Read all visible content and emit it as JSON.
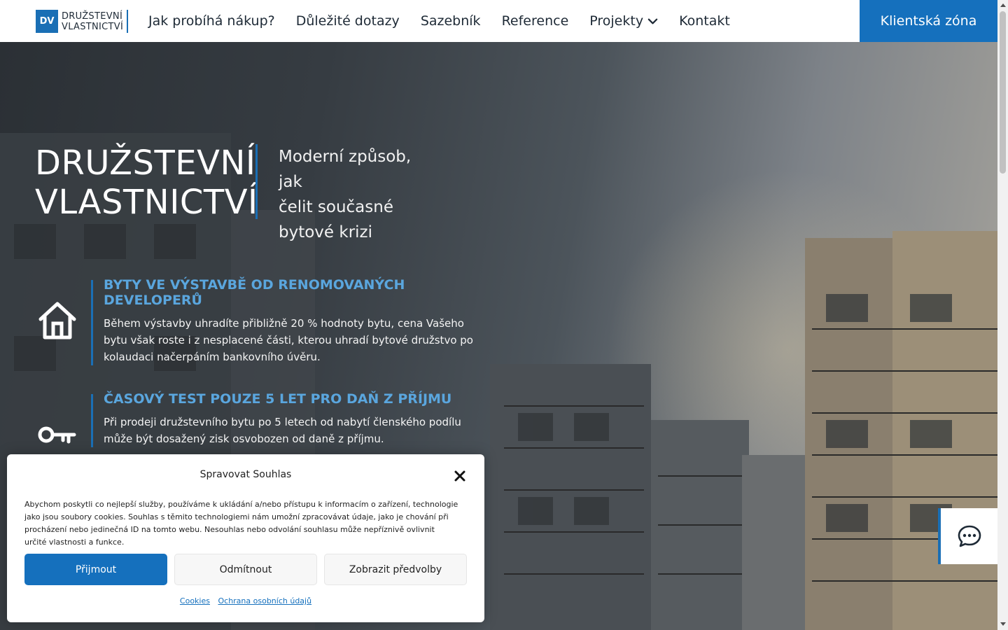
{
  "header": {
    "logo_mark": "DV",
    "logo_line1": "DRUŽSTEVNÍ",
    "logo_line2": "VLASTNICTVÍ",
    "nav": [
      {
        "label": "Jak probíhá nákup?"
      },
      {
        "label": "Důležité dotazy"
      },
      {
        "label": "Sazebník"
      },
      {
        "label": "Reference"
      },
      {
        "label": "Projekty"
      },
      {
        "label": "Kontakt"
      }
    ],
    "client_zone": "Klientská zóna"
  },
  "hero": {
    "title_line1": "DRUŽSTEVNÍ",
    "title_line2": "VLASTNICTVÍ",
    "subtitle_line1": "Moderní způsob, jak",
    "subtitle_line2": "čelit současné",
    "subtitle_line3": "bytové krizi"
  },
  "features": [
    {
      "icon": "house-icon",
      "title": "BYTY VE VÝSTAVBĚ OD RENOMOVANÝCH DEVELOPERŮ",
      "text": "Během výstavby uhradíte přibližně 20 % hodnoty bytu, cena Vašeho bytu však roste i z nesplacené části, kterou uhradí bytové družstvo po kolaudaci načerpáním bankovního úvěru."
    },
    {
      "icon": "key-icon",
      "title": "ČASOVÝ TEST POUZE 5 LET PRO DAŇ Z PŘÍJMU",
      "text": "Při prodeji družstevního bytu po 5 letech od nabytí členského podílu může být dosažený zisk osvobozen od daně z příjmu."
    }
  ],
  "cookie_modal": {
    "title": "Spravovat Souhlas",
    "text": "Abychom poskytli co nejlepší služby, používáme k ukládání a/nebo přístupu k informacím o zařízení, technologie jako jsou soubory cookies. Souhlas s těmito technologiemi nám umožní zpracovávat údaje, jako je chování při procházení nebo jedinečná ID na tomto webu. Nesouhlas nebo odvolání souhlasu může nepříznivě ovlivnit určité vlastnosti a funkce.",
    "accept": "Přijmout",
    "reject": "Odmítnout",
    "preferences": "Zobrazit předvolby",
    "link_cookies": "Cookies",
    "link_privacy": "Ochrana osobních údajů"
  },
  "colors": {
    "accent": "#1570bd",
    "feature_heading": "#5aa6de"
  }
}
